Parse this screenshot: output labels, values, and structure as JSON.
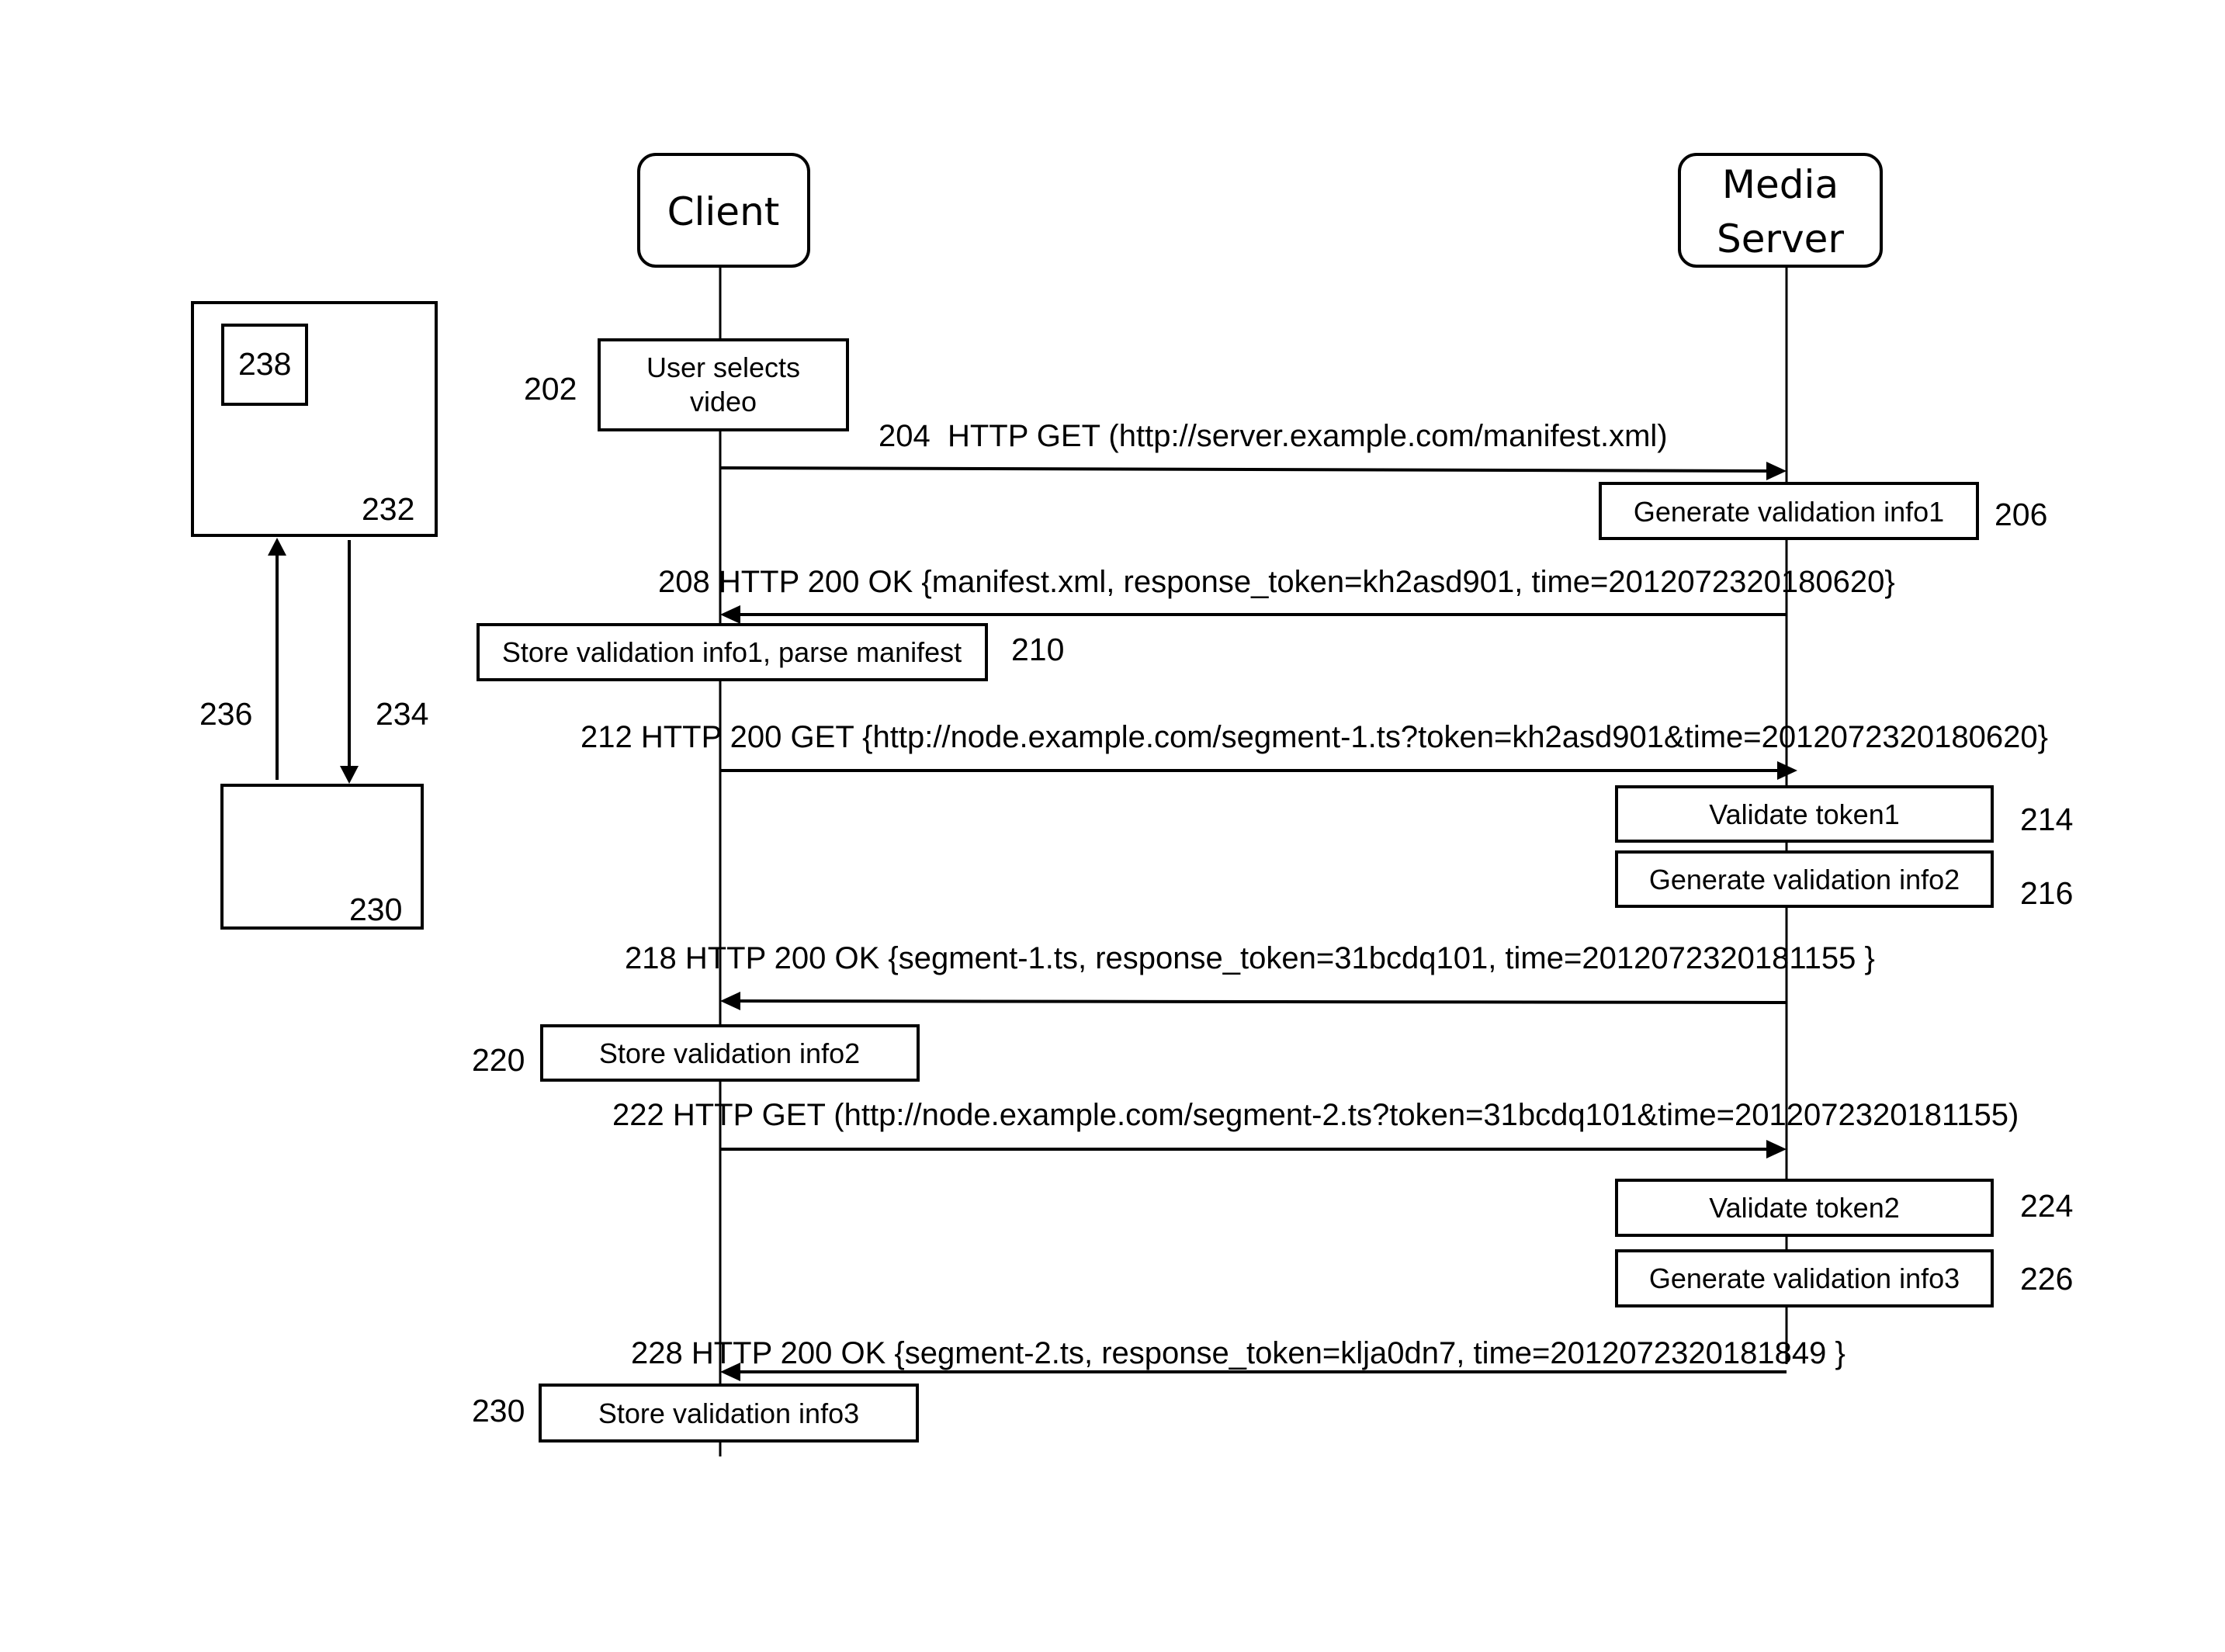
{
  "diagram": {
    "type": "sequence-diagram",
    "actors": {
      "client": {
        "label": "Client"
      },
      "server": {
        "label_line1": "Media",
        "label_line2": "Server"
      }
    },
    "side_blocks": {
      "upper_block_ref": "232",
      "inner_block_ref": "238",
      "lower_block_ref": "230",
      "up_arrow_ref": "236",
      "down_arrow_ref": "234"
    },
    "activities": [
      {
        "ref": "202",
        "lifeline": "client",
        "line1": "User selects",
        "line2": "video"
      },
      {
        "ref": "206",
        "lifeline": "server",
        "text": "Generate validation info1"
      },
      {
        "ref": "210",
        "lifeline": "client",
        "text": "Store validation info1, parse manifest"
      },
      {
        "ref": "214",
        "lifeline": "server",
        "text": "Validate token1"
      },
      {
        "ref": "216",
        "lifeline": "server",
        "text": "Generate validation info2"
      },
      {
        "ref": "220",
        "lifeline": "client",
        "text": "Store validation info2"
      },
      {
        "ref": "224",
        "lifeline": "server",
        "text": "Validate token2"
      },
      {
        "ref": "226",
        "lifeline": "server",
        "text": "Generate validation info3"
      },
      {
        "ref": "230",
        "lifeline": "client",
        "text": "Store validation info3"
      }
    ],
    "messages": [
      {
        "ref": "204",
        "direction": "client-to-server",
        "text": "204  HTTP GET (http://server.example.com/manifest.xml)"
      },
      {
        "ref": "208",
        "direction": "server-to-client",
        "text": "208 HTTP 200 OK {manifest.xml, response_token=kh2asd901, time=201207232018062­0}"
      },
      {
        "ref": "212",
        "direction": "client-to-server",
        "text": "212 HTTP 200 GET {http://node.example.com/segment-1.ts?token=kh2asd901&time=201207232018062­0}"
      },
      {
        "ref": "218",
        "direction": "server-to-client",
        "text": "218 HTTP 200 OK {segment-1.ts, response_token=31bcdq101, time=201207232018115­5 }"
      },
      {
        "ref": "222",
        "direction": "client-to-server",
        "text": "222 HTTP GET (http://node.example.com/segment-2.ts?token=31bcdq101&time=201207232018115­5)"
      },
      {
        "ref": "228",
        "direction": "server-to-client",
        "text": "228 HTTP 200 OK {segment-2.ts, response_token=klja0dn7, time=201207232018184­9 }"
      }
    ]
  }
}
